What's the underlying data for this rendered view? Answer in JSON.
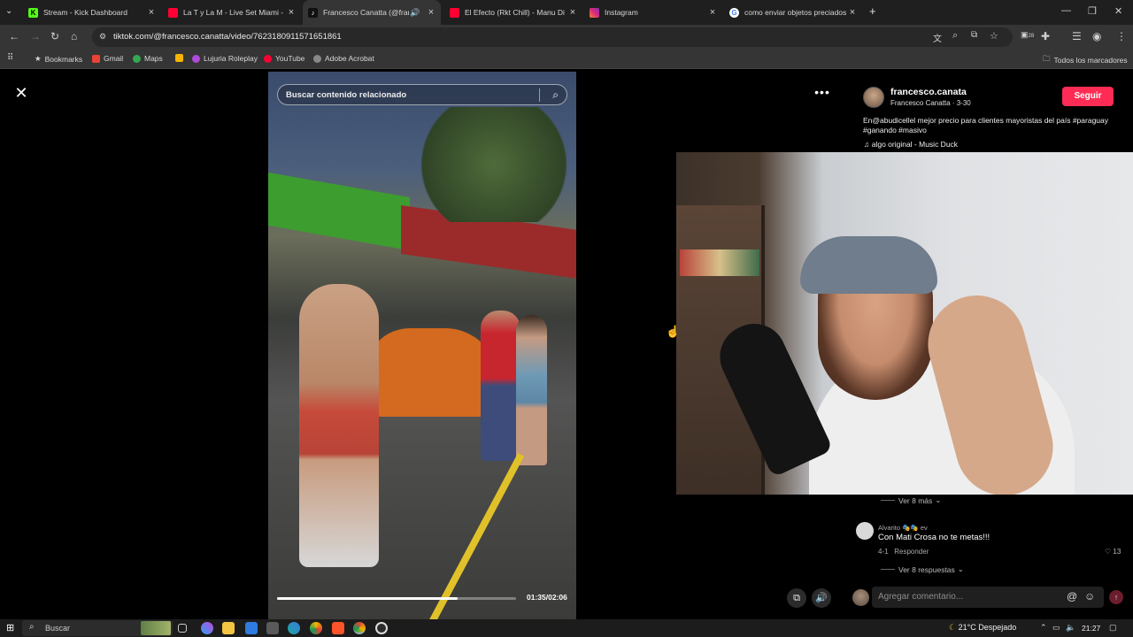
{
  "tabs": [
    {
      "title": "Stream - Kick Dashboard",
      "favicon": "kick-icon",
      "color": "#53fc18",
      "active": false
    },
    {
      "title": "La T y La M - Live Set Miami - Y",
      "favicon": "youtube-icon",
      "color": "#ff0033",
      "active": false
    },
    {
      "title": "Francesco Canatta (@franc",
      "favicon": "tiktok-icon",
      "color": "#ffffff",
      "active": true
    },
    {
      "title": "El Efecto (Rkt Chill) - Manu Di",
      "favicon": "youtube-icon",
      "color": "#ff0033",
      "active": false
    },
    {
      "title": "Instagram",
      "favicon": "instagram-icon",
      "color": "#e1306c",
      "active": false
    },
    {
      "title": "como enviar objetos preciados",
      "favicon": "google-icon",
      "color": "#4285f4",
      "active": false
    }
  ],
  "address": {
    "url": "tiktok.com/@francesco.canatta/video/7623180911571651861"
  },
  "extensions_badge": "28",
  "bookmarks": [
    {
      "label": "Bookmarks",
      "icon": "star-icon"
    },
    {
      "label": "Gmail",
      "icon": "gmail-icon"
    },
    {
      "label": "Maps",
      "icon": "maps-icon"
    },
    {
      "label": "",
      "icon": "bookmark-icon"
    },
    {
      "label": "Lujuria Roleplay",
      "icon": "lujuria-icon"
    },
    {
      "label": "YouTube",
      "icon": "youtube-icon"
    },
    {
      "label": "Adobe Acrobat",
      "icon": "acrobat-icon"
    }
  ],
  "bookmarks_all": "Todos los marcadores",
  "video": {
    "search_placeholder": "Buscar contenido relacionado",
    "time": "01:35/02:06",
    "progress": 0.754
  },
  "author": {
    "username": "francesco.canata",
    "subline": "Francesco Canatta · 3-30",
    "follow_label": "Seguir",
    "caption": "En@abudicellel mejor precio para clientes mayoristas del país #paraguay #ganando #masivo",
    "music": "♫ algo original - Music Duck"
  },
  "comments": {
    "see_more_top": "Ver 8 más",
    "user": "Alvarito 🎭🎭 ev",
    "text": "Con Mati Crosa no te metas!!!",
    "meta_date": "4-1",
    "reply_label": "Responder",
    "likes": "13",
    "see_more_replies": "Ver 8 respuestas",
    "input_placeholder": "Agregar comentario..."
  },
  "taskbar": {
    "search_label": "Buscar",
    "weather": "21°C Despejado",
    "time": "21:27"
  },
  "colors": {
    "accent": "#fe2c55",
    "tab_bg": "#1f1f1f",
    "active_tab": "#353535"
  }
}
